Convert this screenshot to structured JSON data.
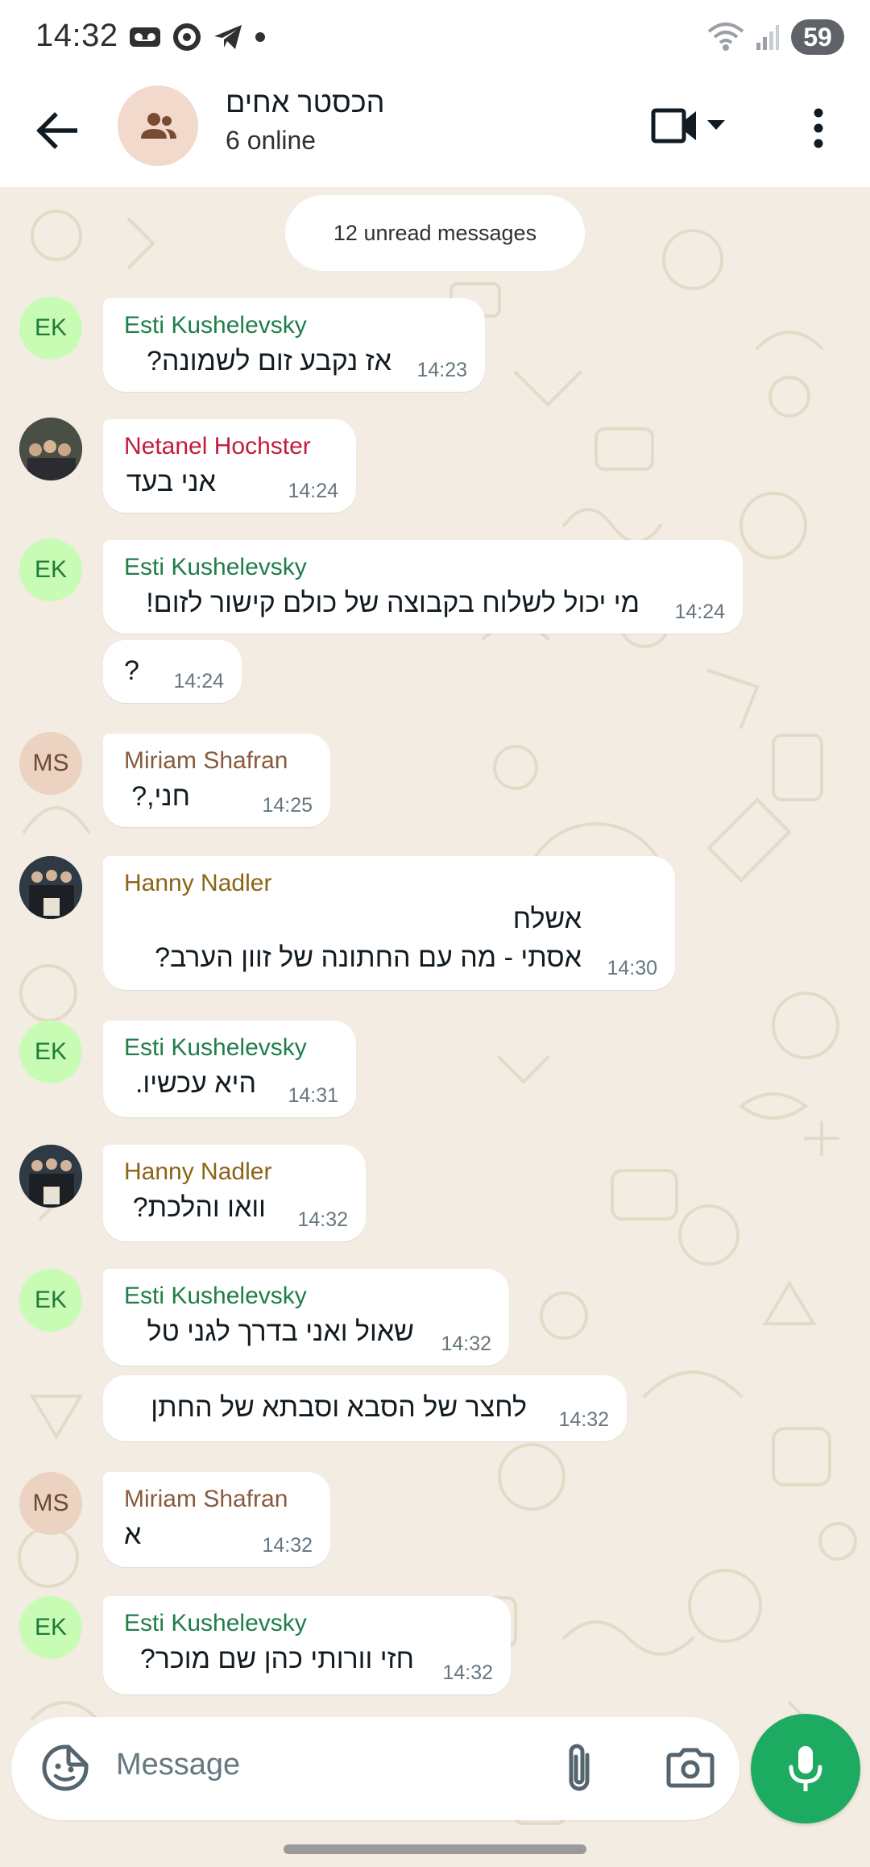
{
  "status_bar": {
    "time": "14:32",
    "battery": "59"
  },
  "header": {
    "group_name": "הכסטר אחים",
    "status": "6 online"
  },
  "unread_banner": "12 unread messages",
  "messages": [
    {
      "sender": "Esti Kushelevsky",
      "initials": "EK",
      "text": "אז נקבע זום לשמונה?",
      "time": "14:23"
    },
    {
      "sender": "Netanel Hochster",
      "initials": "",
      "text": "אני בעד",
      "time": "14:24"
    },
    {
      "sender": "Esti Kushelevsky",
      "initials": "EK",
      "text": "מי יכול לשלוח בקבוצה של כולם קישור לזום!",
      "time": "14:24"
    },
    {
      "sender": "",
      "initials": "",
      "text": "?",
      "time": "14:24"
    },
    {
      "sender": "Miriam Shafran",
      "initials": "MS",
      "text": "חני,?",
      "time": "14:25"
    },
    {
      "sender": "Hanny Nadler",
      "initials": "",
      "text": "אשלח",
      "text2": "אסתי - מה עם החתונה של זוון הערב?",
      "time": "14:30"
    },
    {
      "sender": "Esti Kushelevsky",
      "initials": "EK",
      "text": "היא עכשיו.",
      "time": "14:31"
    },
    {
      "sender": "Hanny Nadler",
      "initials": "",
      "text": "וואו והלכת?",
      "time": "14:32"
    },
    {
      "sender": "Esti Kushelevsky",
      "initials": "EK",
      "text": "שאול ואני בדרך לגני טל",
      "time": "14:32"
    },
    {
      "sender": "",
      "initials": "",
      "text": "לחצר של הסבא וסבתא של החתן",
      "time": "14:32"
    },
    {
      "sender": "Miriam Shafran",
      "initials": "MS",
      "text": "א",
      "time": "14:32"
    },
    {
      "sender": "Esti Kushelevsky",
      "initials": "EK",
      "text": "חזי וורותי כהן שם מוכר?",
      "time": "14:32"
    }
  ],
  "input": {
    "placeholder": "Message"
  },
  "colors": {
    "accent": "#1dab61",
    "chat_background": "#f2ece2",
    "esti_name": "#1f7e4a",
    "netanel_name": "#c41b3c",
    "miriam_name": "#885b3d",
    "hanny_name": "#8b6418"
  },
  "icons": [
    "back-arrow-icon",
    "group-icon",
    "video-call-icon",
    "dropdown-icon",
    "more-vert-icon",
    "sticker-icon",
    "attach-icon",
    "camera-icon",
    "mic-icon"
  ]
}
